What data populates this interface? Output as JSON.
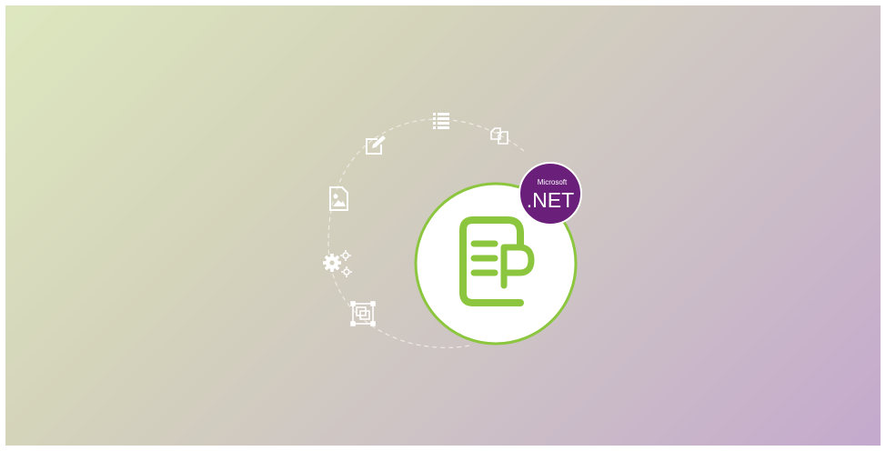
{
  "badge": {
    "brand": "Microsoft",
    "product": ".NET",
    "color": "#6a1f7a"
  },
  "logo": {
    "ring_color": "#8cc63f",
    "mark_color": "#8cc63f",
    "icon": "document-p-icon"
  },
  "feature_icons": [
    {
      "name": "gears-icon"
    },
    {
      "name": "image-icon"
    },
    {
      "name": "edit-icon"
    },
    {
      "name": "list-icon"
    },
    {
      "name": "copy-icon"
    },
    {
      "name": "crop-icon"
    }
  ]
}
